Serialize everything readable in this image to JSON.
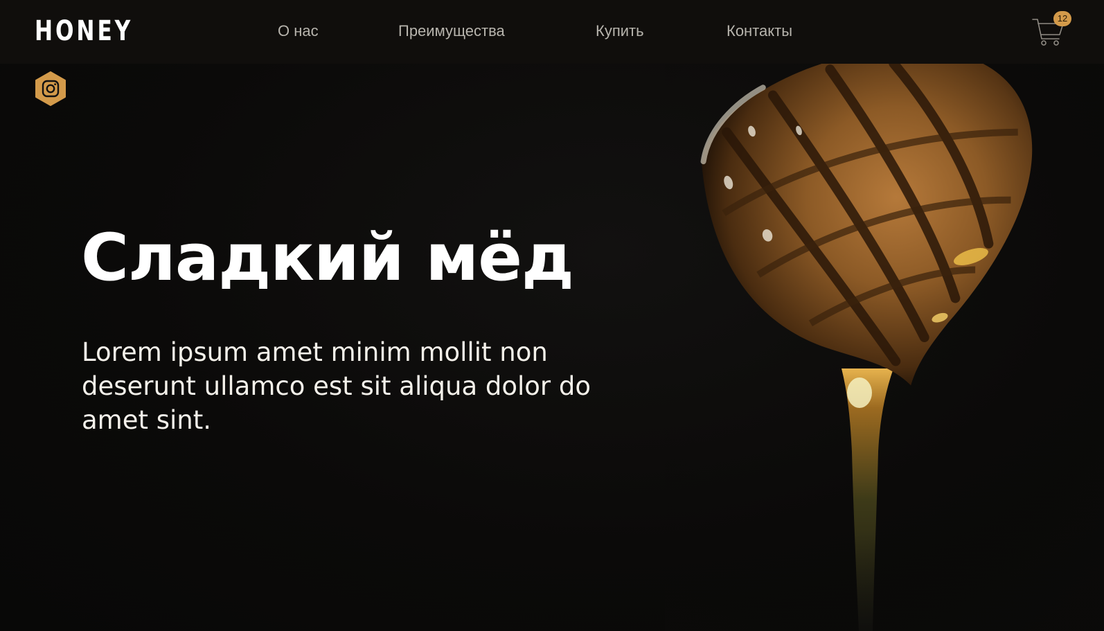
{
  "header": {
    "logo": "HONEY",
    "nav": [
      {
        "label": "О нас"
      },
      {
        "label": "Преимущества"
      },
      {
        "label": "Купить"
      },
      {
        "label": "Контакты"
      }
    ],
    "cart": {
      "icon": "cart-icon",
      "count": "12"
    }
  },
  "social": {
    "icon": "instagram-icon"
  },
  "hero": {
    "title": "Сладкий мёд",
    "text": "Lorem ipsum amet minim mollit non deserunt ullamco est sit aliqua dolor do amet sint."
  },
  "colors": {
    "accent": "#d39a4a",
    "background": "#0b0a09",
    "header_background": "#100e0c",
    "nav_text": "#b7b4ad",
    "hero_text": "#ffffff"
  }
}
